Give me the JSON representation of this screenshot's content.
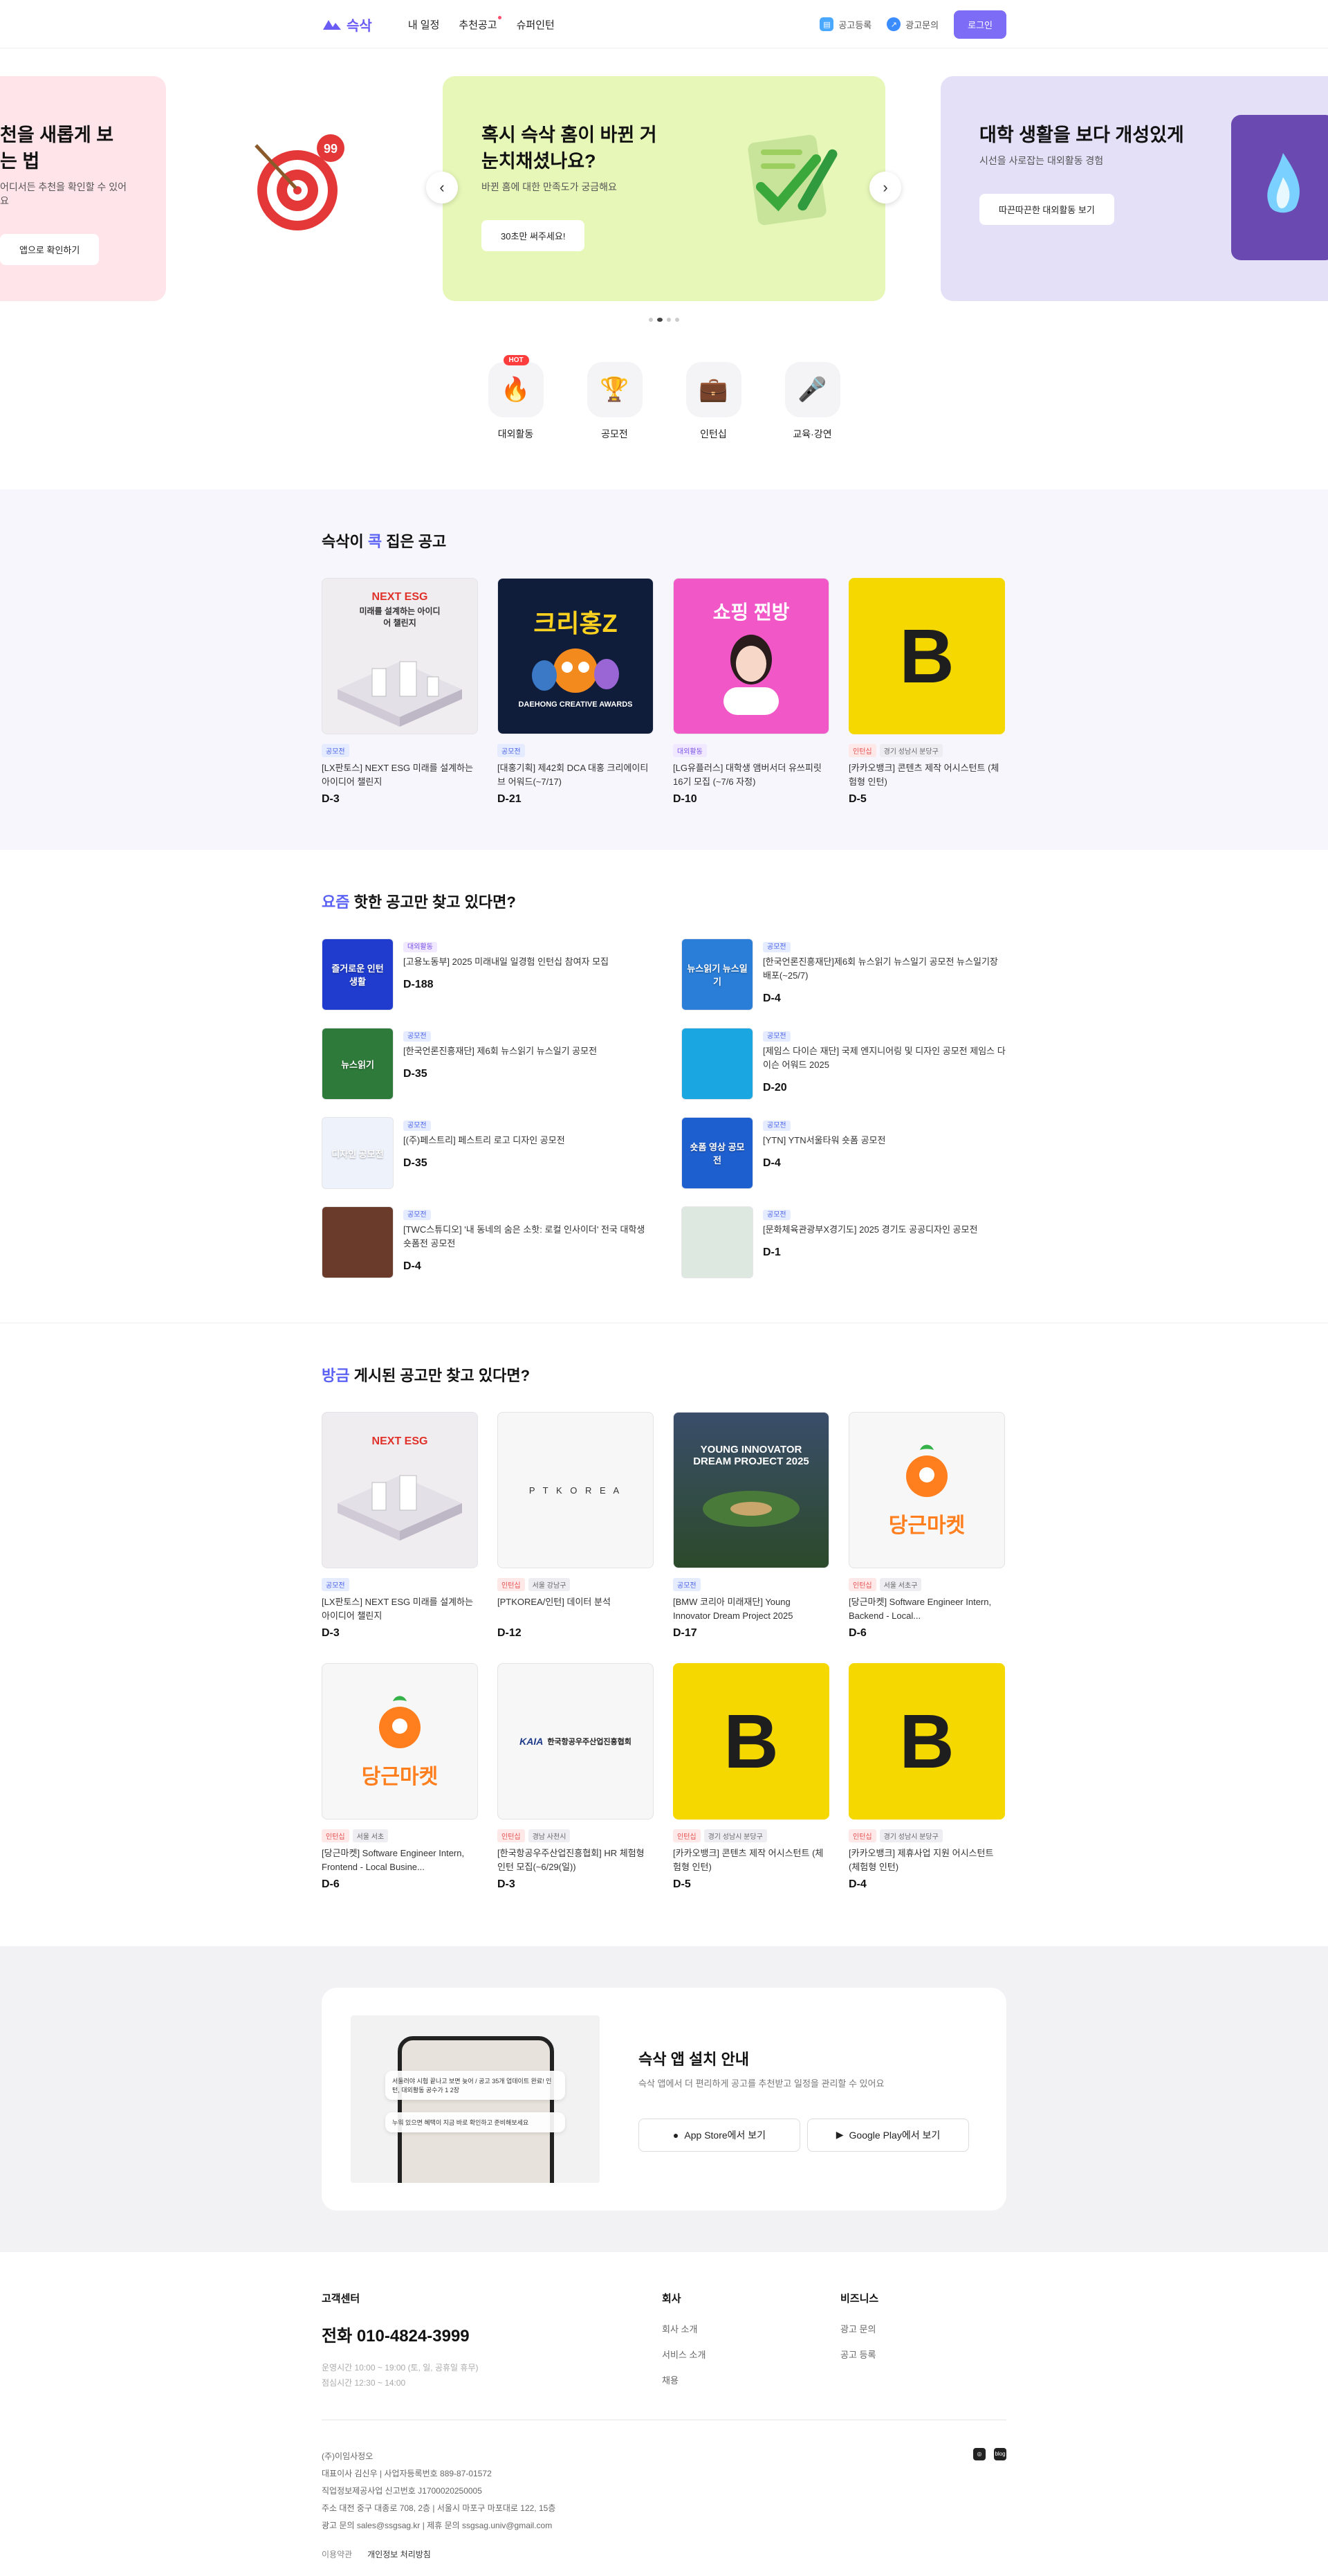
{
  "header": {
    "logo_text": "슥삭",
    "nav": [
      "내 일정",
      "추천공고",
      "슈퍼인턴"
    ],
    "ad_register": "공고등록",
    "ad_inquiry": "광고문의",
    "login": "로그인"
  },
  "banners": [
    {
      "title_line1": "천을 새롭게 보는 법",
      "title_line2": "",
      "subtitle": "어디서든 추천을 확인할 수 있어요",
      "button": "앱으로 확인하기",
      "bg": "#ffe4ea"
    },
    {
      "title_line1": "혹시 슥삭 홈이 바뀐 거",
      "title_line2": "눈치채셨나요?",
      "subtitle": "바뀐 홈에 대한 만족도가 궁금해요",
      "button": "30초만 써주세요!",
      "bg": "#e6f7b8"
    },
    {
      "title_line1": "대학 생활을 보다 개성있게",
      "title_line2": "",
      "subtitle": "시선을 사로잡는 대외활동 경험",
      "button": "따끈따끈한 대외활동 보기",
      "bg": "#e4e0f8"
    }
  ],
  "categories": {
    "hot_badge": "HOT",
    "items": [
      {
        "label": "대외활동",
        "icon": "fire-icon",
        "glyph": "🔥"
      },
      {
        "label": "공모전",
        "icon": "trophy-icon",
        "glyph": "🏆"
      },
      {
        "label": "인턴십",
        "icon": "briefcase-icon",
        "glyph": "💼"
      },
      {
        "label": "교육·강연",
        "icon": "microphone-icon",
        "glyph": "🎤"
      }
    ]
  },
  "picked": {
    "title_pre": "슥삭이 ",
    "title_hl": "콕",
    "title_post": " 집은 공고",
    "items": [
      {
        "tags": [
          "공모전"
        ],
        "title": "[LX판토스] NEXT ESG 미래를 설계하는 아이디어 챌린지",
        "dday": "D-3",
        "img_text": "NEXT ESG",
        "img_sub": "미래를 설계하는 아이디어 챌린지",
        "bg": "#f0eef0"
      },
      {
        "tags": [
          "공모전"
        ],
        "title": "[대홍기획] 제42회 DCA 대홍 크리에이티브 어워드(~7/17)",
        "dday": "D-21",
        "img_text": "크리홍Z",
        "img_sub": "DAEHONG CREATIVE AWARDS",
        "bg": "#0f1d3a"
      },
      {
        "tags": [
          "대외활동"
        ],
        "title": "[LG유플러스] 대학생 앰버서더 유쓰피릿 16기 모집 (~7/6 자정)",
        "dday": "D-10",
        "img_text": "쇼핑 찐방",
        "img_sub": "",
        "bg": "#f257c8"
      },
      {
        "tags": [
          "인턴십",
          "경기 성남시 분당구"
        ],
        "title": "[카카오뱅크] 콘텐츠 제작 어시스턴트 (체험형 인턴)",
        "dday": "D-5",
        "img_text": "B",
        "img_sub": "",
        "bg": "#f4d800"
      }
    ]
  },
  "hot": {
    "title_hl": "요즘",
    "title_post": " 핫한 공고만 찾고 있다면?",
    "items": [
      {
        "tag": "대외활동",
        "title": "[고용노동부] 2025 미래내일 일경험 인턴십 참여자 모집",
        "dday": "D-188",
        "bg": "#1f3ccf",
        "img_text": "즐거로운 인턴 생활"
      },
      {
        "tag": "공모전",
        "title": "[한국언론진흥재단]제6회 뉴스읽기 뉴스일기 공모전 뉴스일기장 배포(~25/7)",
        "dday": "D-4",
        "bg": "#2a7ed8",
        "img_text": "뉴스읽기 뉴스일기"
      },
      {
        "tag": "공모전",
        "title": "[한국언론진흥재단] 제6회 뉴스읽기 뉴스일기 공모전",
        "dday": "D-35",
        "bg": "#2d7a3a",
        "img_text": "뉴스읽기"
      },
      {
        "tag": "공모전",
        "title": "[제임스 다이슨 재단] 국제 엔지니어링 및 디자인 공모전 제임스 다이슨 어워드 2025",
        "dday": "D-20",
        "bg": "#1aa6e0",
        "img_text": ""
      },
      {
        "tag": "공모전",
        "title": "[(주)페스트리] 페스트리 로고 디자인 공모전",
        "dday": "D-35",
        "bg": "#eef3fb",
        "img_text": "디자인 공모전"
      },
      {
        "tag": "공모전",
        "title": "[YTN] YTN서울타워 숏폼 공모전",
        "dday": "D-4",
        "bg": "#1e5fd0",
        "img_text": "숏폼 영상 공모전"
      },
      {
        "tag": "공모전",
        "title": "[TWC스튜디오] '내 동네의 숨은 소핫: 로컬 인사이더' 전국 대학생 숏폼전 공모전",
        "dday": "D-4",
        "bg": "#6a3a2a",
        "img_text": ""
      },
      {
        "tag": "공모전",
        "title": "[문화체육관광부X경기도] 2025 경기도 공공디자인 공모전",
        "dday": "D-1",
        "bg": "#dde9e0",
        "img_text": ""
      }
    ]
  },
  "recent": {
    "title_hl": "방금",
    "title_post": " 게시된 공고만 찾고 있다면?",
    "items": [
      {
        "tags": [
          "공모전"
        ],
        "title": "[LX판토스] NEXT ESG 미래를 설계하는 아이디어 챌린지",
        "dday": "D-3",
        "kind": "esg"
      },
      {
        "tags": [
          "인턴십",
          "서울 강남구"
        ],
        "title": "[PTKOREA/인턴] 데이터 분석",
        "dday": "D-12",
        "kind": "ptk",
        "img_text": "P T K O R E A"
      },
      {
        "tags": [
          "공모전"
        ],
        "title": "[BMW 코리아 미래재단] Young Innovator Dream Project 2025",
        "dday": "D-17",
        "kind": "bmw",
        "img_text": "YOUNG INNOVATOR DREAM PROJECT 2025"
      },
      {
        "tags": [
          "인턴십",
          "서울 서초구"
        ],
        "title": "[당근마켓] Software Engineer Intern, Backend - Local...",
        "dday": "D-6",
        "kind": "carrot",
        "img_text": "당근마켓"
      },
      {
        "tags": [
          "인턴십",
          "서울 서초"
        ],
        "title": "[당근마켓] Software Engineer Intern, Frontend - Local Busine...",
        "dday": "D-6",
        "kind": "carrot",
        "img_text": "당근마켓"
      },
      {
        "tags": [
          "인턴십",
          "경남 사천시"
        ],
        "title": "[한국항공우주산업진흥협회] HR 체험형 인턴 모집(~6/29(일))",
        "dday": "D-3",
        "kind": "kaia",
        "img_text": "한국항공우주산업진흥협회"
      },
      {
        "tags": [
          "인턴십",
          "경기 성남시 분당구"
        ],
        "title": "[카카오뱅크] 콘텐츠 제작 어시스턴트 (체험형 인턴)",
        "dday": "D-5",
        "kind": "b"
      },
      {
        "tags": [
          "인턴십",
          "경기 성남시 분당구"
        ],
        "title": "[카카오뱅크] 제휴사업 지원 어시스턴트 (체험형 인턴)",
        "dday": "D-4",
        "kind": "b"
      }
    ]
  },
  "app": {
    "title": "슥삭 앱 설치 안내",
    "desc": "슥삭 앱에서 더 편리하게 공고를 추천받고 일정을 관리할 수 있어요",
    "appstore": "App Store에서 보기",
    "playstore": "Google Play에서 보기",
    "notif1": "서둘러야 시험 끝나고 보면 늦어 / 공고 35개 업데이트 완료! 인턴, 대외활동 공수가 1 2장",
    "notif2": "누워 있으면 혜택이 지금 바로 확인하고 준비해보세요"
  },
  "footer": {
    "cs_title": "고객센터",
    "phone": "전화 010-4824-3999",
    "hours1": "운영시간 10:00 ~ 19:00 (토, 일, 공휴일 휴무)",
    "hours2": "점심시간 12:30 ~ 14:00",
    "company_title": "회사",
    "company_links": [
      "회사 소개",
      "서비스 소개",
      "채용"
    ],
    "biz_title": "비즈니스",
    "biz_links": [
      "광고 문의",
      "공고 등록"
    ],
    "corp": "(주)이임사정오",
    "ceo": "대표이사 김신우  |  사업자등록번호 889-87-01572",
    "license": "직업정보제공사업 신고번호 J1700020250005",
    "address": "주소 대전 중구 대종로 708, 2층  |  서울시 마포구 마포대로 122, 15층",
    "contact": "광고 문의 sales@ssgsag.kr  |  제휴 문의 ssgsag.univ@gmail.com",
    "terms": "이용약관",
    "privacy": "개인정보 처리방침"
  }
}
